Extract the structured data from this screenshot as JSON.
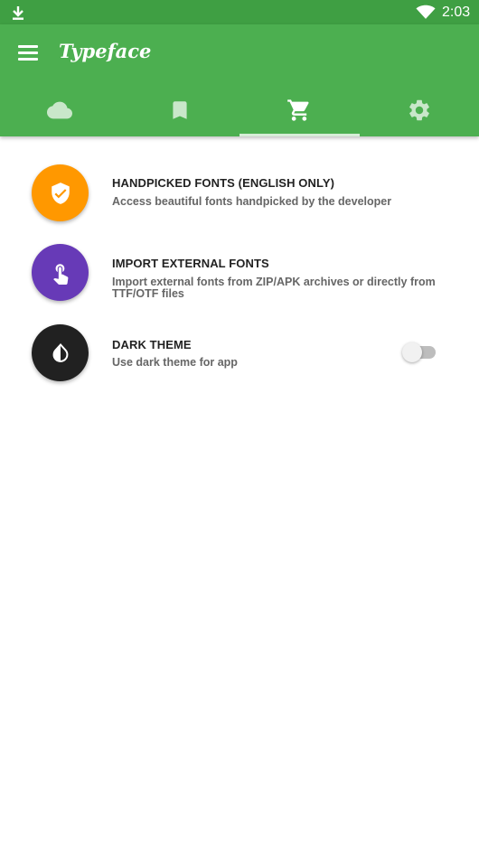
{
  "status_bar": {
    "time": "2:03",
    "icons": [
      "download-icon",
      "wifi-icon"
    ]
  },
  "app_bar": {
    "title": "Typeface",
    "tabs": [
      {
        "icon": "cloud-icon",
        "active": false
      },
      {
        "icon": "bookmark-icon",
        "active": false
      },
      {
        "icon": "shopping-cart-icon",
        "active": true
      },
      {
        "icon": "gear-icon",
        "active": false
      }
    ]
  },
  "colors": {
    "status_bar": "#3f9f43",
    "app_bar": "#4caf50",
    "handpicked": "#ff9800",
    "import": "#673ab7",
    "dark_theme": "#212121"
  },
  "items": [
    {
      "icon": "verified-shield-icon",
      "title": "HANDPICKED FONTS (ENGLISH ONLY)",
      "subtitle": "Access beautiful fonts handpicked by the developer"
    },
    {
      "icon": "touch-app-icon",
      "title": "IMPORT EXTERNAL FONTS",
      "subtitle": "Import external fonts from ZIP/APK archives or directly from TTF/OTF files"
    },
    {
      "icon": "invert-colors-icon",
      "title": "DARK THEME",
      "subtitle": "Use dark theme for app",
      "toggle_on": false
    }
  ]
}
